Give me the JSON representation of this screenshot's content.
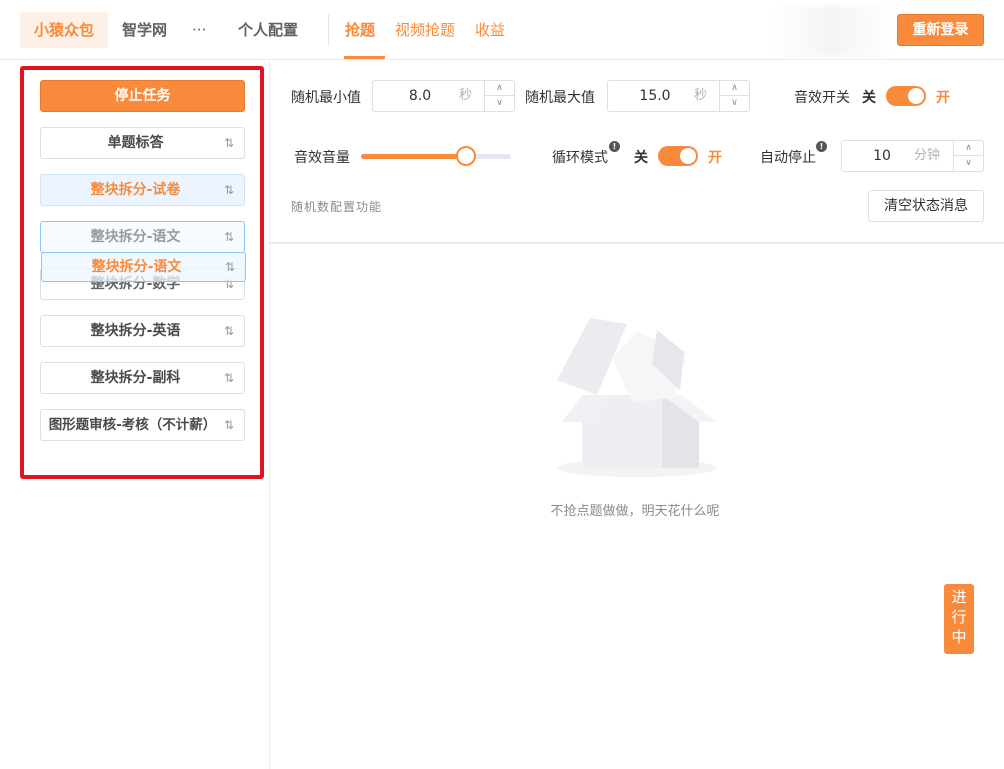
{
  "header": {
    "tabs": [
      {
        "label": "小猿众包"
      },
      {
        "label": "智学网"
      },
      {
        "label": "···"
      },
      {
        "label": "个人配置"
      }
    ],
    "subtabs": [
      {
        "label": "抢题"
      },
      {
        "label": "视频抢题"
      },
      {
        "label": "收益"
      }
    ],
    "relogin_label": "重新登录"
  },
  "sidebar": {
    "stop_label": "停止任务",
    "tasks": [
      {
        "label": "单题标答"
      },
      {
        "label": "整块拆分-试卷"
      },
      {
        "label": "整块拆分-语文"
      },
      {
        "label": "整块拆分-数学"
      },
      {
        "label": "整块拆分-英语"
      },
      {
        "label": "整块拆分-副科"
      },
      {
        "label": "图形题审核-考核（不计薪）"
      }
    ],
    "dragging_label": "整块拆分-语文",
    "sort_icon": "⇅"
  },
  "settings": {
    "min": {
      "label": "随机最小值",
      "value": "8.0",
      "unit": "秒"
    },
    "max": {
      "label": "随机最大值",
      "value": "15.0",
      "unit": "秒"
    },
    "sound_switch": {
      "label": "音效开关",
      "off": "关",
      "on": "开",
      "state": true
    },
    "volume": {
      "label": "音效音量",
      "level": 0.7
    },
    "loop": {
      "label": "循环模式",
      "off": "关",
      "on": "开",
      "state": true
    },
    "auto_stop": {
      "label": "自动停止",
      "value": "10",
      "unit": "分钟"
    },
    "info_glyph": "!",
    "note": "随机数配置功能",
    "clear_label": "清空状态消息"
  },
  "empty": {
    "text": "不抢点题做做，明天花什么呢"
  },
  "status": {
    "running_label": "进行中"
  },
  "colors": {
    "accent": "#f98a3c",
    "highlight": "#e3141f"
  }
}
